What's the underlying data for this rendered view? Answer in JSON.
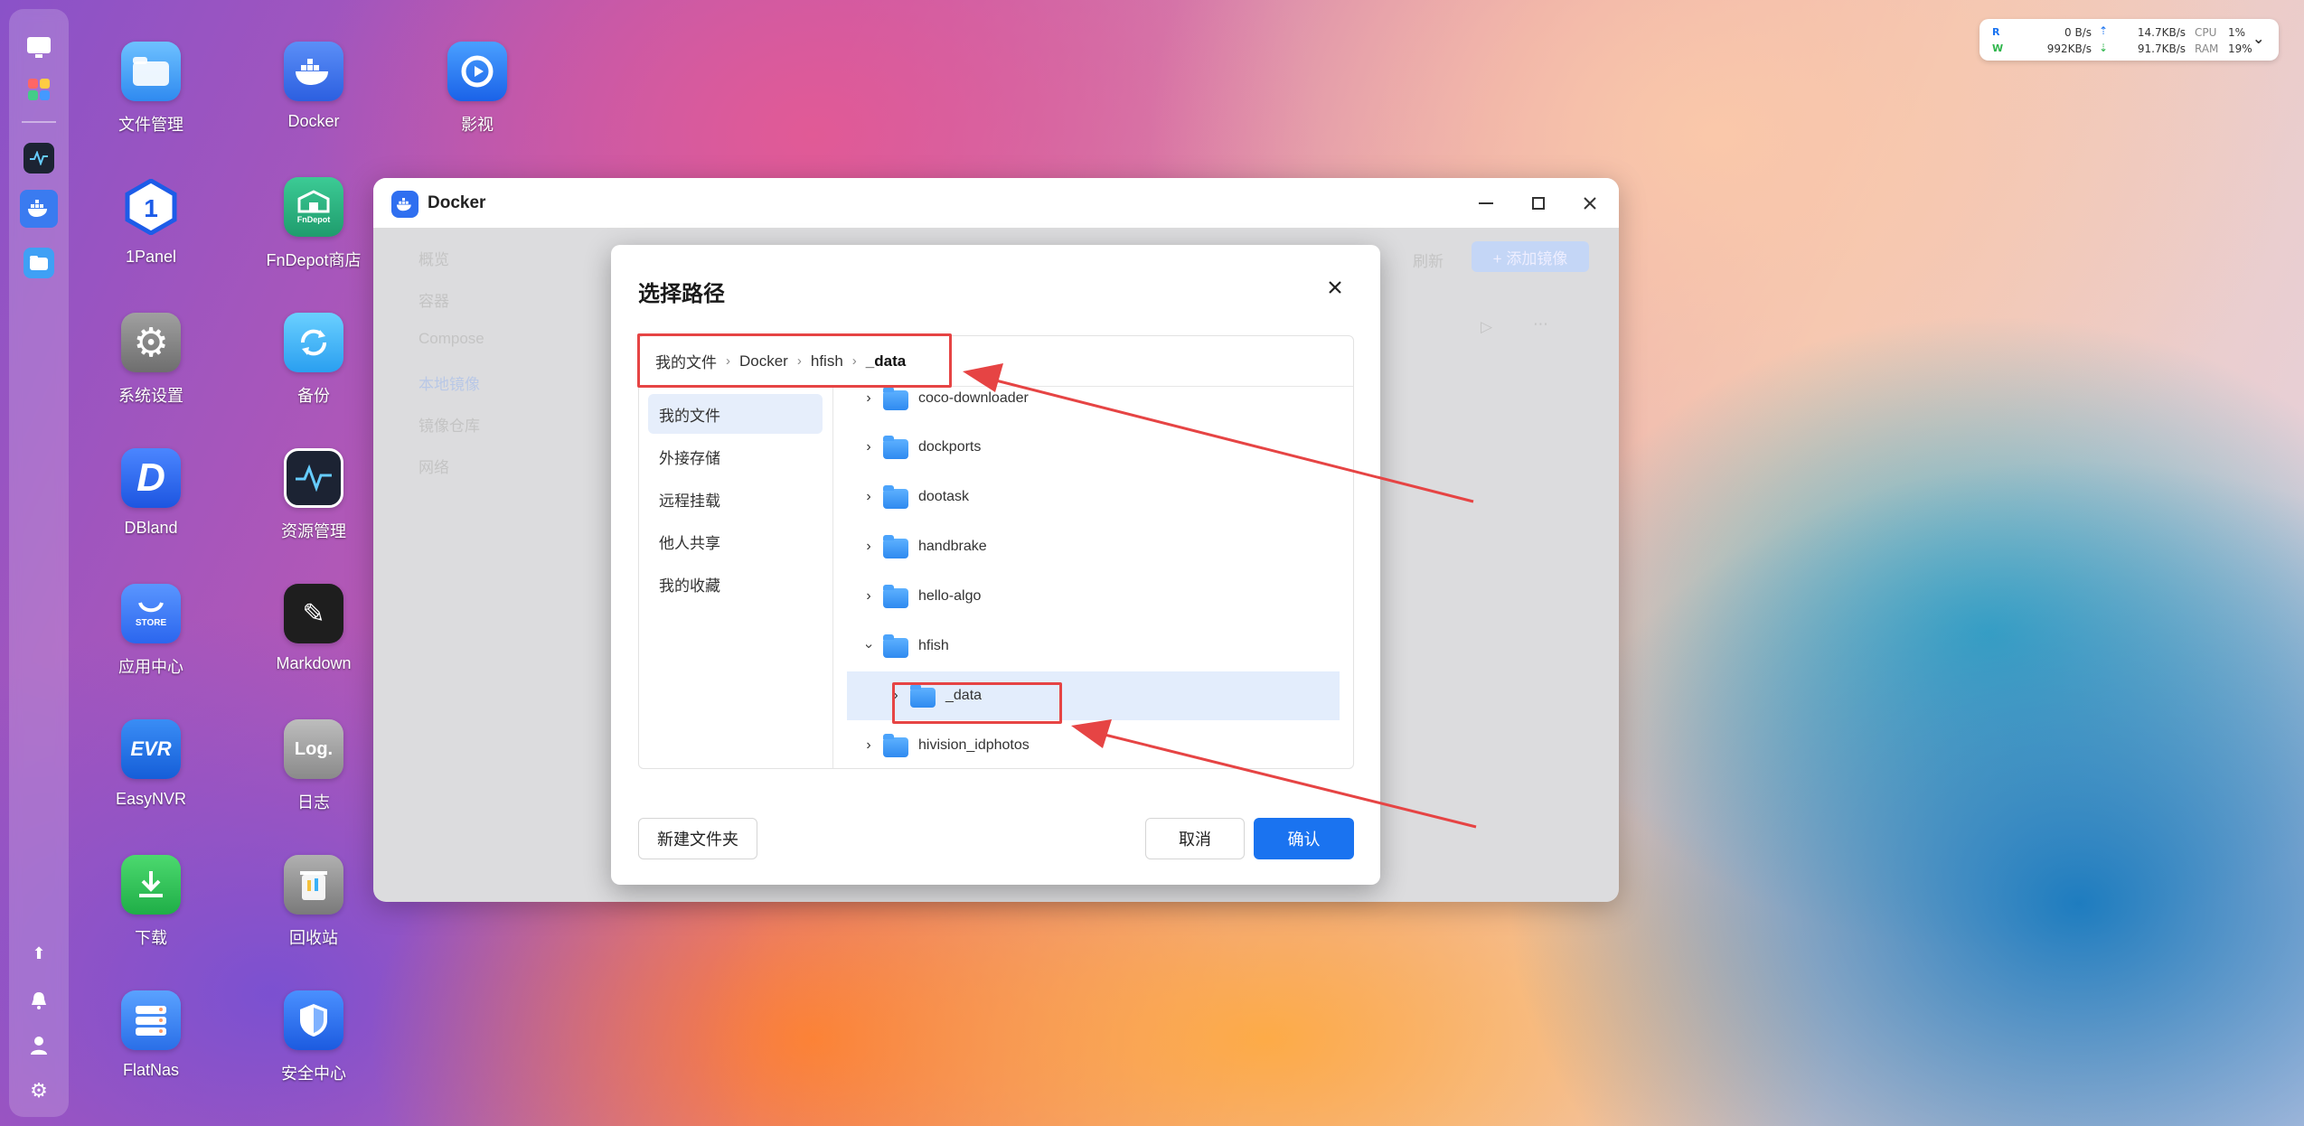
{
  "monitor": {
    "r_label": "R",
    "w_label": "W",
    "disk_read": "0  B/s",
    "disk_write": "992KB/s",
    "net_up": "14.7KB/s",
    "net_down": "91.7KB/s",
    "cpu_label": "CPU",
    "cpu_value": "1%",
    "ram_label": "RAM",
    "ram_value": "19%"
  },
  "desktop": {
    "apps": [
      {
        "label": "文件管理",
        "color": "#3fa0f5"
      },
      {
        "label": "Docker",
        "color": "#3a7bf0"
      },
      {
        "label": "影视",
        "color": "#1e6ff0"
      },
      {
        "label": "1Panel",
        "color": "#ffffff"
      },
      {
        "label": "FnDepot商店",
        "color": "#2fb88a"
      },
      {
        "label": "系统设置",
        "color": "#8a8a8a"
      },
      {
        "label": "备份",
        "color": "#3ab5f5"
      },
      {
        "label": "DBland",
        "color": "#2a6bf2"
      },
      {
        "label": "资源管理",
        "color": "#1c2333"
      },
      {
        "label": "应用中心",
        "color": "#3a7cf5"
      },
      {
        "label": "Markdown",
        "color": "#222222"
      },
      {
        "label": "EasyNVR",
        "color": "#1e78e8"
      },
      {
        "label": "日志",
        "color": "#9a9a9a"
      },
      {
        "label": "下载",
        "color": "#2fbf55"
      },
      {
        "label": "回收站",
        "color": "#8b8b8b"
      },
      {
        "label": "FlatNas",
        "color": "#3a8af2"
      },
      {
        "label": "安全中心",
        "color": "#1f6fe5"
      }
    ],
    "glyphs": {
      "fnDepot": "FnDepot",
      "store": "STORE",
      "easynvr": "EVR",
      "log": "Log.",
      "dbland": "D",
      "onepanel": "1"
    }
  },
  "window": {
    "title": "Docker",
    "sidebar_faded": [
      "概览",
      "容器",
      "Compose",
      "本地镜像",
      "镜像仓库",
      "网络"
    ],
    "toolbar_faded": {
      "refresh": "刷新",
      "add": "+ 添加镜像"
    }
  },
  "dialog": {
    "title": "选择路径",
    "breadcrumb": [
      "我的文件",
      "Docker",
      "hfish",
      "_data"
    ],
    "sidebar": [
      "我的文件",
      "外接存储",
      "远程挂载",
      "他人共享",
      "我的收藏"
    ],
    "tree": [
      {
        "name": "coco-downloader",
        "expanded": false
      },
      {
        "name": "dockports",
        "expanded": false
      },
      {
        "name": "dootask",
        "expanded": false
      },
      {
        "name": "handbrake",
        "expanded": false
      },
      {
        "name": "hello-algo",
        "expanded": false
      },
      {
        "name": "hfish",
        "expanded": true
      },
      {
        "name": "_data",
        "child": true,
        "selected": true
      },
      {
        "name": "hivision_idphotos",
        "expanded": false
      }
    ],
    "new_folder": "新建文件夹",
    "cancel": "取消",
    "confirm": "确认"
  },
  "colors": {
    "primary": "#1a73f0",
    "annotation": "#e64444",
    "selected_bg": "#e3edfc"
  }
}
